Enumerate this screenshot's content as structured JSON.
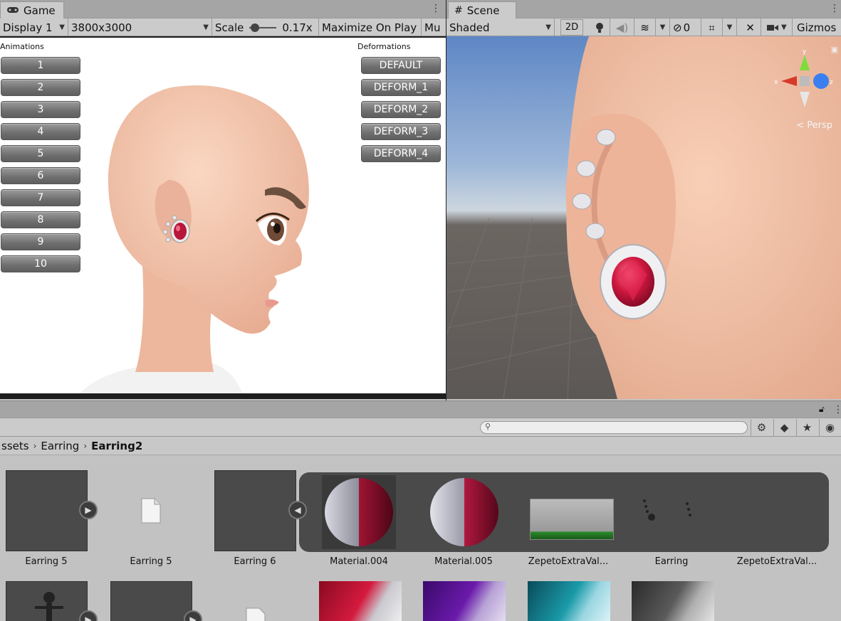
{
  "game": {
    "tab_label": "Game",
    "display": "Display 1",
    "resolution": "3800x3000",
    "scale_label": "Scale",
    "scale_value": "0.17x",
    "maximize": "Maximize On Play",
    "mute": "Mu",
    "animations_label": "Animations",
    "deformations_label": "Deformations",
    "animation_buttons": [
      "1",
      "2",
      "3",
      "4",
      "5",
      "6",
      "7",
      "8",
      "9",
      "10"
    ],
    "deformation_buttons": [
      "DEFAULT",
      "DEFORM_1",
      "DEFORM_2",
      "DEFORM_3",
      "DEFORM_4"
    ]
  },
  "scene": {
    "tab_label": "Scene",
    "shading": "Shaded",
    "mode_2d": "2D",
    "hidden_count": "0",
    "gizmos": "Gizmos",
    "persp": "< Persp",
    "axis_x": "x",
    "axis_z": "z",
    "axis_y": "y"
  },
  "project": {
    "breadcrumb": [
      "ssets",
      "Earring",
      "Earring2"
    ],
    "assets_row1": [
      "Earring 5",
      "Earring 5",
      "Earring 6",
      "Material.004",
      "Material.005",
      "ZepetoExtraVal...",
      "Earring",
      "ZepetoExtraVal..."
    ]
  },
  "colors": {
    "editor_bg": "#c2c2c2",
    "skin": "#f3c3a8",
    "ruby": "#c21838",
    "sky": "#7fa2d2"
  },
  "icons": [
    "gamepad-icon",
    "grid-icon",
    "kebab-icon",
    "lightbulb-icon",
    "audio-icon",
    "layers-icon",
    "eye-off-icon",
    "move-tool-icon",
    "tools-icon",
    "camera-icon",
    "lock-icon",
    "search-icon",
    "filter-icon",
    "tag-icon",
    "star-icon",
    "eye-icon",
    "file-icon",
    "play-icon"
  ]
}
